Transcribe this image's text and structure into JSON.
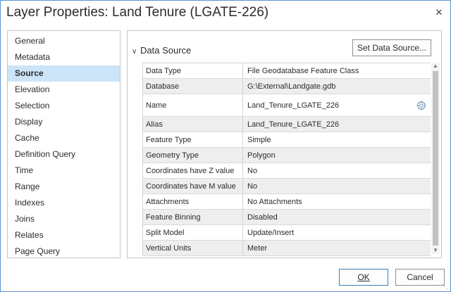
{
  "window": {
    "title": "Layer Properties: Land Tenure (LGATE-226)",
    "close_glyph": "✕"
  },
  "sidebar": {
    "items": [
      {
        "label": "General"
      },
      {
        "label": "Metadata"
      },
      {
        "label": "Source",
        "selected": true
      },
      {
        "label": "Elevation"
      },
      {
        "label": "Selection"
      },
      {
        "label": "Display"
      },
      {
        "label": "Cache"
      },
      {
        "label": "Definition Query"
      },
      {
        "label": "Time"
      },
      {
        "label": "Range"
      },
      {
        "label": "Indexes"
      },
      {
        "label": "Joins"
      },
      {
        "label": "Relates"
      },
      {
        "label": "Page Query"
      }
    ]
  },
  "main": {
    "section_title": "Data Source",
    "section_expanded": true,
    "set_data_source_label": "Set Data Source...",
    "properties": [
      {
        "key": "Data Type",
        "value": "File Geodatabase Feature Class"
      },
      {
        "key": "Database",
        "value": "G:\\External\\Landgate.gdb"
      },
      {
        "key": "Name",
        "value": "Land_Tenure_LGATE_226",
        "icon": "locate-icon"
      },
      {
        "key": "Alias",
        "value": "Land_Tenure_LGATE_226"
      },
      {
        "key": "Feature Type",
        "value": "Simple"
      },
      {
        "key": "Geometry Type",
        "value": "Polygon"
      },
      {
        "key": "Coordinates have Z value",
        "value": "No"
      },
      {
        "key": "Coordinates have M value",
        "value": "No"
      },
      {
        "key": "Attachments",
        "value": "No Attachments"
      },
      {
        "key": "Feature Binning",
        "value": "Disabled"
      },
      {
        "key": "Split Model",
        "value": "Update/Insert"
      },
      {
        "key": "Vertical Units",
        "value": "Meter"
      }
    ]
  },
  "footer": {
    "ok_label": "OK",
    "cancel_label": "Cancel"
  },
  "colors": {
    "accent_selected": "#cce4f7",
    "window_border": "#5a93cf",
    "alt_row": "#eeeeee"
  }
}
